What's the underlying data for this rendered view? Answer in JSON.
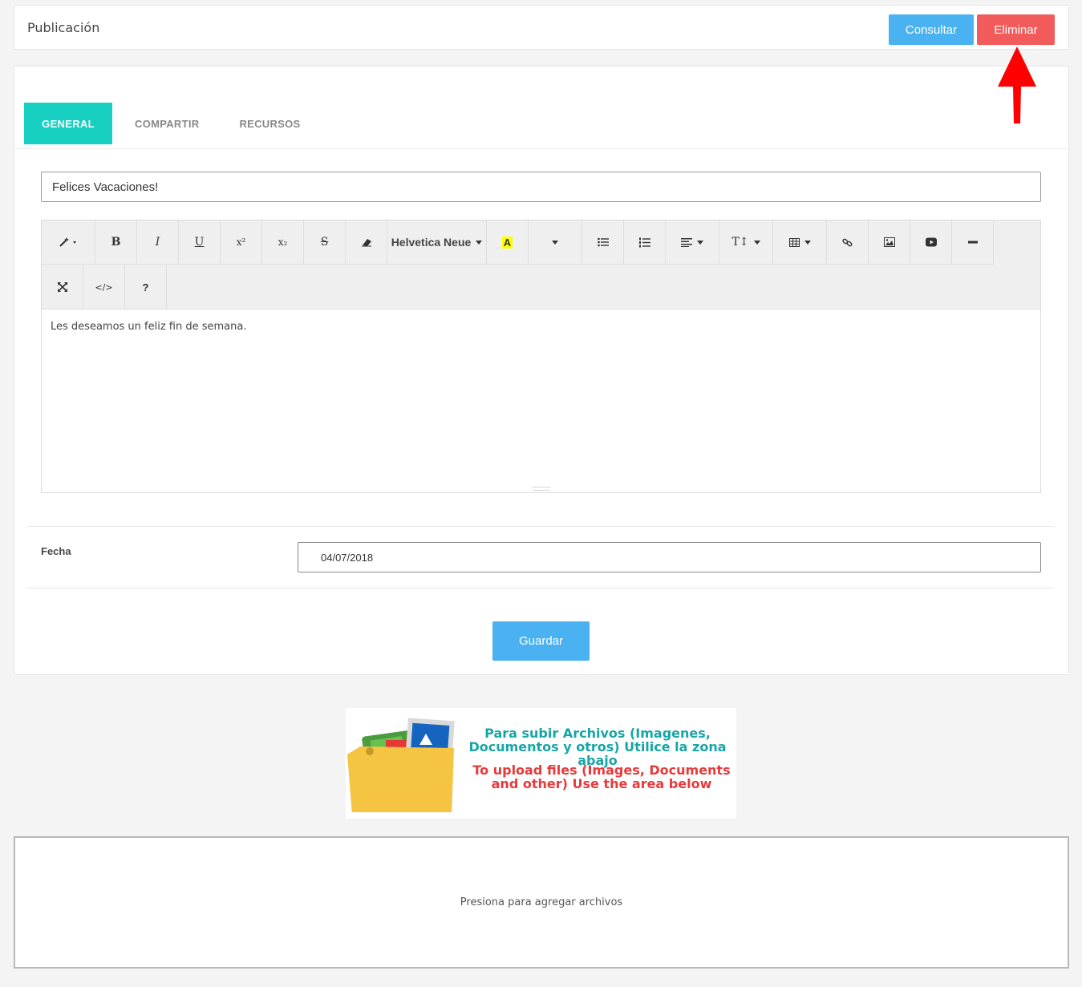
{
  "header": {
    "title": "Publicación",
    "consultar_label": "Consultar",
    "eliminar_label": "Eliminar"
  },
  "tabs": [
    {
      "label": "GENERAL",
      "active": true
    },
    {
      "label": "COMPARTIR",
      "active": false
    },
    {
      "label": "RECURSOS",
      "active": false
    }
  ],
  "form": {
    "title_value": "Felices Vacaciones!",
    "editor": {
      "font_name": "Helvetica Neue",
      "body_text": "Les deseamos un feliz fin de semana.",
      "toolbar_icons": [
        "magic-icon",
        "bold-icon",
        "italic-icon",
        "underline-icon",
        "superscript-icon",
        "subscript-icon",
        "strikethrough-icon",
        "eraser-icon",
        "font-name-dropdown",
        "highlight-color-icon",
        "color-dropdown",
        "unordered-list-icon",
        "ordered-list-icon",
        "align-icon",
        "text-height-icon",
        "table-icon",
        "link-icon",
        "picture-icon",
        "video-icon",
        "horizontal-rule-icon",
        "fullscreen-icon",
        "code-view-icon",
        "help-icon"
      ]
    },
    "fecha_label": "Fecha",
    "fecha_value": "04/07/2018",
    "guardar_label": "Guardar"
  },
  "upload_banner": {
    "spanish_text": "Para subir Archivos (Imagenes, Documentos y otros) Utilice la zona abajo",
    "english_text": "To upload files (Images, Documents and other) Use the area below"
  },
  "dropzone": {
    "text": "Presiona para agregar archivos"
  },
  "colors": {
    "accent_tab": "#17cfc1",
    "primary_button": "#4ab2f1",
    "danger_button": "#f15b5b",
    "arrow": "#ff0000"
  }
}
